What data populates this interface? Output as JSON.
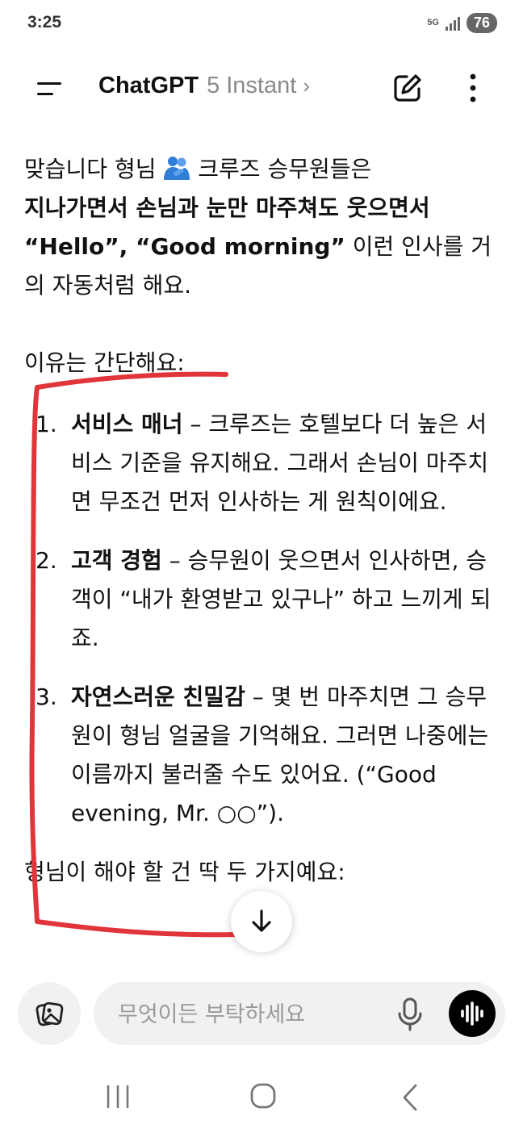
{
  "status_bar": {
    "time": "3:25",
    "network": "5G",
    "battery": "76"
  },
  "header": {
    "app_name": "ChatGPT",
    "model": "5 Instant",
    "chevron": "›"
  },
  "message": {
    "intro_pre": "맞습니다 형님 ",
    "intro_emoji": "people-hugging",
    "intro_mid": " 크루즈 승무원들은",
    "intro_bold": "지나가면서 손님과 눈만 마주쳐도 웃으면서 “Hello”, “Good morning”",
    "intro_post": " 이런 인사를 거의 자동처럼 해요.",
    "reasons_intro": "이유는 간단해요:",
    "reasons": [
      {
        "num": "1.",
        "title": "서비스 매너",
        "text": " – 크루즈는 호텔보다 더 높은 서비스 기준을 유지해요. 그래서 손님이 마주치면 무조건 먼저 인사하는 게 원칙이에요."
      },
      {
        "num": "2.",
        "title": "고객 경험",
        "text": " – 승무원이 웃으면서 인사하면, 승객이 “내가 환영받고 있구나” 하고 느끼게 되죠."
      },
      {
        "num": "3.",
        "title": "자연스러운 친밀감",
        "text": " – 몇 번 마주치면 그 승무원이 형님 얼굴을 기억해요. 그러면 나중에는 이름까지 불러줄 수도 있어요. (“Good evening, Mr. ○○”)."
      }
    ],
    "closing": "형님이 해야 할 건 딱 두 가지예요:"
  },
  "composer": {
    "placeholder": "무엇이든 부탁하세요"
  },
  "colors": {
    "annotation": "#e0353b",
    "voice_button": "#000000",
    "pill_bg": "#f1f1f1"
  },
  "icons": {
    "menu": "menu-icon",
    "edit": "new-chat-icon",
    "more": "more-vert-icon",
    "scroll": "arrow-down-icon",
    "attach": "image-attach-icon",
    "mic": "mic-icon",
    "voice": "voice-waveform-icon",
    "nav_recent": "recent-apps-icon",
    "nav_home": "home-icon",
    "nav_back": "back-icon"
  }
}
